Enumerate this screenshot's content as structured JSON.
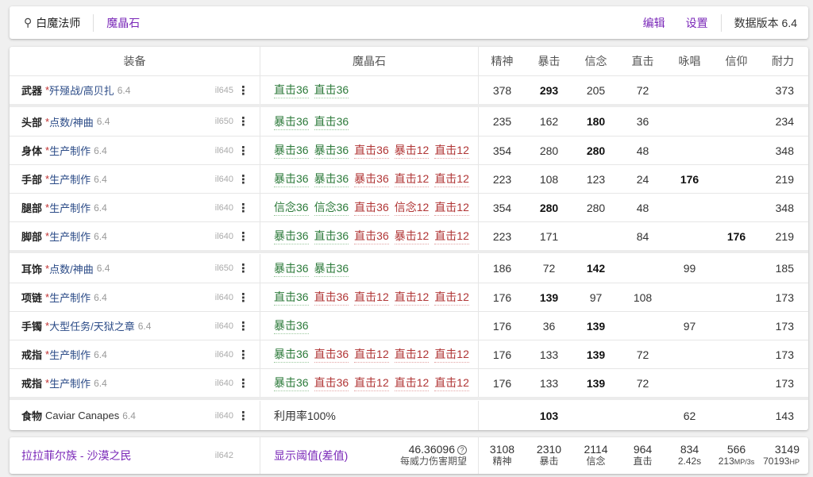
{
  "topbar": {
    "job": "白魔法师",
    "gear_set": "魔晶石",
    "edit": "编辑",
    "settings": "设置",
    "version": "数据版本 6.4"
  },
  "header": {
    "equip": "装备",
    "meld": "魔晶石",
    "stats": [
      "精神",
      "暴击",
      "信念",
      "直击",
      "咏唱",
      "信仰",
      "耐力"
    ]
  },
  "rows": [
    {
      "slot": "武器",
      "star": "*",
      "name": "歼殛战/高贝扎",
      "ver": "6.4",
      "ilvl": "il645",
      "melds": [
        {
          "t": "直击36",
          "c": "g"
        },
        {
          "t": "直击36",
          "c": "g"
        }
      ],
      "stats": [
        "378",
        "293",
        "205",
        "72",
        "",
        "",
        "373"
      ],
      "bold": [
        1
      ]
    },
    {
      "slot": "头部",
      "star": "*",
      "name": "点数/神曲",
      "ver": "6.4",
      "ilvl": "il650",
      "melds": [
        {
          "t": "暴击36",
          "c": "g"
        },
        {
          "t": "直击36",
          "c": "g"
        }
      ],
      "stats": [
        "235",
        "162",
        "180",
        "36",
        "",
        "",
        "234"
      ],
      "bold": [
        2
      ]
    },
    {
      "slot": "身体",
      "star": "*",
      "name": "生产制作",
      "ver": "6.4",
      "ilvl": "il640",
      "melds": [
        {
          "t": "暴击36",
          "c": "g"
        },
        {
          "t": "暴击36",
          "c": "g"
        },
        {
          "t": "直击36",
          "c": "r"
        },
        {
          "t": "暴击12",
          "c": "r"
        },
        {
          "t": "直击12",
          "c": "r"
        }
      ],
      "stats": [
        "354",
        "280",
        "280",
        "48",
        "",
        "",
        "348"
      ],
      "bold": [
        2
      ]
    },
    {
      "slot": "手部",
      "star": "*",
      "name": "生产制作",
      "ver": "6.4",
      "ilvl": "il640",
      "melds": [
        {
          "t": "暴击36",
          "c": "g"
        },
        {
          "t": "暴击36",
          "c": "g"
        },
        {
          "t": "暴击36",
          "c": "r"
        },
        {
          "t": "直击12",
          "c": "r"
        },
        {
          "t": "直击12",
          "c": "r"
        }
      ],
      "stats": [
        "223",
        "108",
        "123",
        "24",
        "176",
        "",
        "219"
      ],
      "bold": [
        4
      ]
    },
    {
      "slot": "腿部",
      "star": "*",
      "name": "生产制作",
      "ver": "6.4",
      "ilvl": "il640",
      "melds": [
        {
          "t": "信念36",
          "c": "g"
        },
        {
          "t": "信念36",
          "c": "g"
        },
        {
          "t": "直击36",
          "c": "r"
        },
        {
          "t": "信念12",
          "c": "r"
        },
        {
          "t": "直击12",
          "c": "r"
        }
      ],
      "stats": [
        "354",
        "280",
        "280",
        "48",
        "",
        "",
        "348"
      ],
      "bold": [
        1
      ]
    },
    {
      "slot": "脚部",
      "star": "*",
      "name": "生产制作",
      "ver": "6.4",
      "ilvl": "il640",
      "melds": [
        {
          "t": "暴击36",
          "c": "g"
        },
        {
          "t": "直击36",
          "c": "g"
        },
        {
          "t": "直击36",
          "c": "r"
        },
        {
          "t": "暴击12",
          "c": "r"
        },
        {
          "t": "直击12",
          "c": "r"
        }
      ],
      "stats": [
        "223",
        "171",
        "",
        "84",
        "",
        "176",
        "219"
      ],
      "bold": [
        5
      ]
    },
    {
      "slot": "耳饰",
      "star": "*",
      "name": "点数/神曲",
      "ver": "6.4",
      "ilvl": "il650",
      "melds": [
        {
          "t": "暴击36",
          "c": "g"
        },
        {
          "t": "暴击36",
          "c": "g"
        }
      ],
      "stats": [
        "186",
        "72",
        "142",
        "",
        "99",
        "",
        "185"
      ],
      "bold": [
        2
      ]
    },
    {
      "slot": "项链",
      "star": "*",
      "name": "生产制作",
      "ver": "6.4",
      "ilvl": "il640",
      "melds": [
        {
          "t": "直击36",
          "c": "g"
        },
        {
          "t": "直击36",
          "c": "r"
        },
        {
          "t": "直击12",
          "c": "r"
        },
        {
          "t": "直击12",
          "c": "r"
        },
        {
          "t": "直击12",
          "c": "r"
        }
      ],
      "stats": [
        "176",
        "139",
        "97",
        "108",
        "",
        "",
        "173"
      ],
      "bold": [
        1
      ]
    },
    {
      "slot": "手镯",
      "star": "*",
      "name": "大型任务/天狱之章",
      "ver": "6.4",
      "ilvl": "il640",
      "melds": [
        {
          "t": "暴击36",
          "c": "g"
        }
      ],
      "stats": [
        "176",
        "36",
        "139",
        "",
        "97",
        "",
        "173"
      ],
      "bold": [
        2
      ]
    },
    {
      "slot": "戒指",
      "star": "*",
      "name": "生产制作",
      "ver": "6.4",
      "ilvl": "il640",
      "melds": [
        {
          "t": "暴击36",
          "c": "g"
        },
        {
          "t": "直击36",
          "c": "r"
        },
        {
          "t": "直击12",
          "c": "r"
        },
        {
          "t": "直击12",
          "c": "r"
        },
        {
          "t": "直击12",
          "c": "r"
        }
      ],
      "stats": [
        "176",
        "133",
        "139",
        "72",
        "",
        "",
        "173"
      ],
      "bold": [
        2
      ]
    },
    {
      "slot": "戒指",
      "star": "*",
      "name": "生产制作",
      "ver": "6.4",
      "ilvl": "il640",
      "melds": [
        {
          "t": "暴击36",
          "c": "g"
        },
        {
          "t": "直击36",
          "c": "r"
        },
        {
          "t": "直击12",
          "c": "r"
        },
        {
          "t": "直击12",
          "c": "r"
        },
        {
          "t": "直击12",
          "c": "r"
        }
      ],
      "stats": [
        "176",
        "133",
        "139",
        "72",
        "",
        "",
        "173"
      ],
      "bold": [
        2
      ]
    },
    {
      "slot": "食物",
      "star": "",
      "name": "Caviar Canapes",
      "ver": "6.4",
      "ilvl": "il640",
      "melds": [],
      "plain": "利用率100%",
      "stats": [
        "",
        "103",
        "",
        "",
        "62",
        "",
        "143"
      ],
      "bold": [
        1
      ]
    }
  ],
  "footer": {
    "race": "拉拉菲尔族 - 沙漠之民",
    "ilvl": "il642",
    "threshold": "显示阈值(差值)",
    "dmg_value": "46.36096",
    "dmg_label": "每威力伤害期望",
    "help_icon": "?",
    "stats": [
      {
        "v": "3108",
        "l": "精神"
      },
      {
        "v": "2310",
        "l": "暴击"
      },
      {
        "v": "2114",
        "l": "信念"
      },
      {
        "v": "964",
        "l": "直击"
      },
      {
        "v": "834",
        "l": "2.42s"
      },
      {
        "v": "566",
        "l": "213",
        "lu": "MP/3s"
      },
      {
        "v": "3149",
        "l": "70193",
        "lu": "HP"
      }
    ]
  },
  "colors": {
    "accent": "#7a28b8",
    "meld_good": "#2c7a3a",
    "meld_bad": "#b03535",
    "item_name": "#2b4b87"
  },
  "icons": {
    "job": "staff-icon",
    "row_menu": "kebab-icon",
    "help": "question-circle-icon"
  }
}
